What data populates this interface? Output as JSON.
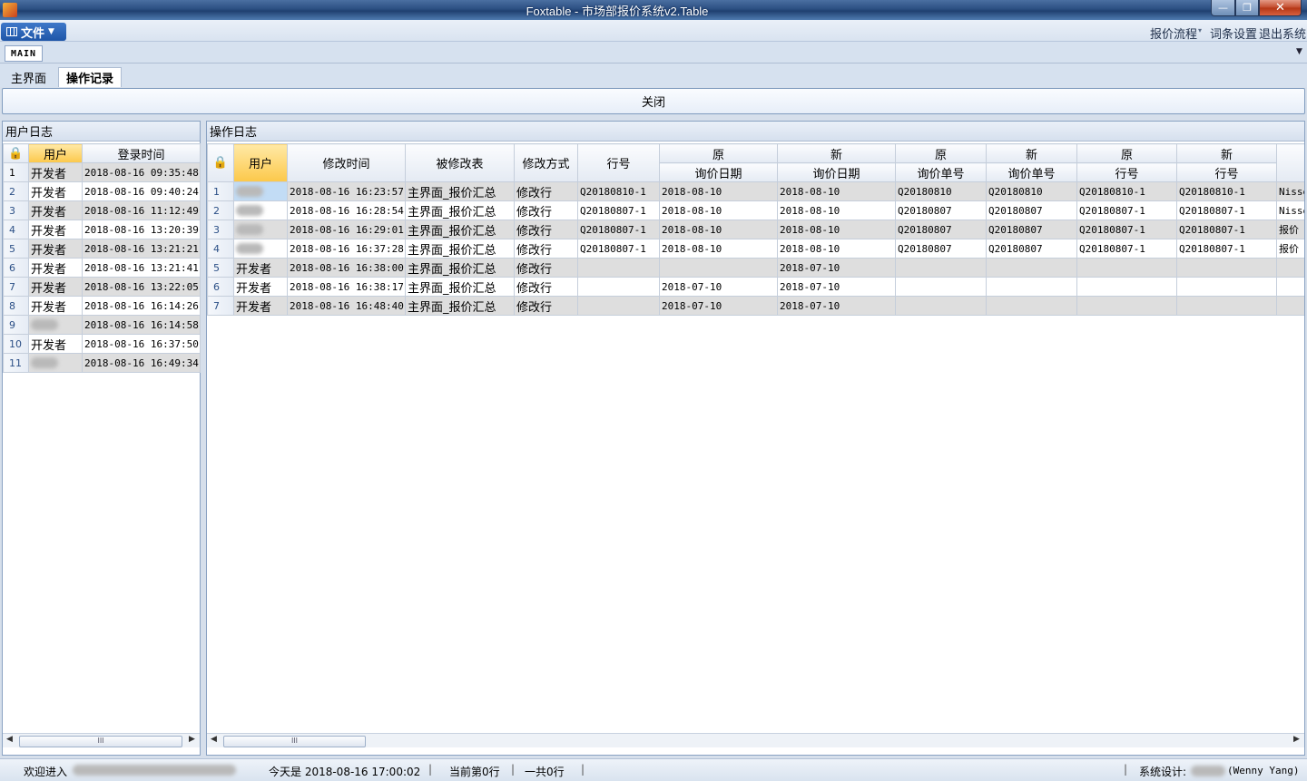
{
  "window": {
    "title": "Foxtable - 市场部报价系统v2.Table",
    "minimize_glyph": "—",
    "maximize_glyph": "❐",
    "close_glyph": "✕"
  },
  "menu": {
    "file_label": "文件",
    "right_links": [
      "报价流程",
      "词条设置",
      "退出系统"
    ],
    "flow_arrow": "▾"
  },
  "main_tab": {
    "label": "MAIN",
    "dropdown_glyph": "▼"
  },
  "sub_tabs": [
    "主界面",
    "操作记录"
  ],
  "close_button": "关闭",
  "user_log": {
    "title": "用户日志",
    "columns": [
      "用户",
      "登录时间"
    ],
    "rows": [
      {
        "n": "1",
        "user": "开发者",
        "time": "2018-08-16 09:35:48"
      },
      {
        "n": "2",
        "user": "开发者",
        "time": "2018-08-16 09:40:24"
      },
      {
        "n": "3",
        "user": "开发者",
        "time": "2018-08-16 11:12:49"
      },
      {
        "n": "4",
        "user": "开发者",
        "time": "2018-08-16 13:20:39"
      },
      {
        "n": "5",
        "user": "开发者",
        "time": "2018-08-16 13:21:21"
      },
      {
        "n": "6",
        "user": "开发者",
        "time": "2018-08-16 13:21:41"
      },
      {
        "n": "7",
        "user": "开发者",
        "time": "2018-08-16 13:22:05"
      },
      {
        "n": "8",
        "user": "开发者",
        "time": "2018-08-16 16:14:26"
      },
      {
        "n": "9",
        "user": "",
        "time": "2018-08-16 16:14:58"
      },
      {
        "n": "10",
        "user": "开发者",
        "time": "2018-08-16 16:37:50"
      },
      {
        "n": "11",
        "user": "",
        "time": "2018-08-16 16:49:34"
      }
    ]
  },
  "op_log": {
    "title": "操作日志",
    "columns": [
      "用户",
      "修改时间",
      "被修改表",
      "修改方式",
      "行号"
    ],
    "group_headers": [
      {
        "top": "原",
        "bottom": "询价日期"
      },
      {
        "top": "新",
        "bottom": "询价日期"
      },
      {
        "top": "原",
        "bottom": "询价单号"
      },
      {
        "top": "新",
        "bottom": "询价单号"
      },
      {
        "top": "原",
        "bottom": "行号"
      },
      {
        "top": "新",
        "bottom": "行号"
      }
    ],
    "rows": [
      {
        "n": "1",
        "user": "",
        "time": "2018-08-16 16:23:57",
        "table": "主界面_报价汇总",
        "mode": "修改行",
        "row": "Q20180810-1",
        "d1": "2018-08-10",
        "d2": "2018-08-10",
        "q1": "Q20180810",
        "q2": "Q20180810",
        "r1": "Q20180810-1",
        "r2": "Q20180810-1",
        "extra": "Nisse"
      },
      {
        "n": "2",
        "user": "",
        "time": "2018-08-16 16:28:54",
        "table": "主界面_报价汇总",
        "mode": "修改行",
        "row": "Q20180807-1",
        "d1": "2018-08-10",
        "d2": "2018-08-10",
        "q1": "Q20180807",
        "q2": "Q20180807",
        "r1": "Q20180807-1",
        "r2": "Q20180807-1",
        "extra": "Nisse"
      },
      {
        "n": "3",
        "user": "",
        "time": "2018-08-16 16:29:01",
        "table": "主界面_报价汇总",
        "mode": "修改行",
        "row": "Q20180807-1",
        "d1": "2018-08-10",
        "d2": "2018-08-10",
        "q1": "Q20180807",
        "q2": "Q20180807",
        "r1": "Q20180807-1",
        "r2": "Q20180807-1",
        "extra": "报价"
      },
      {
        "n": "4",
        "user": "",
        "time": "2018-08-16 16:37:28",
        "table": "主界面_报价汇总",
        "mode": "修改行",
        "row": "Q20180807-1",
        "d1": "2018-08-10",
        "d2": "2018-08-10",
        "q1": "Q20180807",
        "q2": "Q20180807",
        "r1": "Q20180807-1",
        "r2": "Q20180807-1",
        "extra": "报价"
      },
      {
        "n": "5",
        "user": "开发者",
        "time": "2018-08-16 16:38:00",
        "table": "主界面_报价汇总",
        "mode": "修改行",
        "row": "",
        "d1": "",
        "d2": "2018-07-10",
        "q1": "",
        "q2": "",
        "r1": "",
        "r2": "",
        "extra": ""
      },
      {
        "n": "6",
        "user": "开发者",
        "time": "2018-08-16 16:38:17",
        "table": "主界面_报价汇总",
        "mode": "修改行",
        "row": "",
        "d1": "2018-07-10",
        "d2": "2018-07-10",
        "q1": "",
        "q2": "",
        "r1": "",
        "r2": "",
        "extra": ""
      },
      {
        "n": "7",
        "user": "开发者",
        "time": "2018-08-16 16:48:40",
        "table": "主界面_报价汇总",
        "mode": "修改行",
        "row": "",
        "d1": "2018-07-10",
        "d2": "2018-07-10",
        "q1": "",
        "q2": "",
        "r1": "",
        "r2": "",
        "extra": ""
      }
    ]
  },
  "status": {
    "welcome": "欢迎进入",
    "today": "今天是 2018-08-16 17:00:02",
    "current_row": "当前第0行",
    "total": "一共0行",
    "designer_label": "系统设计:",
    "designer_name": "(Wenny Yang)",
    "separator": "|"
  },
  "icons": {
    "lock": "🔒",
    "scroll_left": "◀",
    "scroll_right": "▶",
    "thumb_grip": "III"
  }
}
